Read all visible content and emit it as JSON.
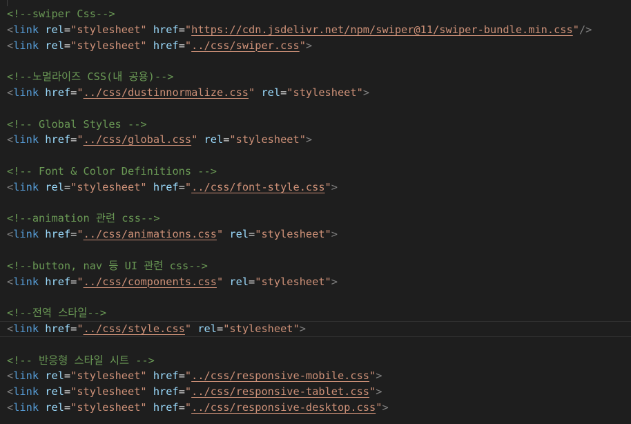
{
  "theme": {
    "background": "#1e1e1e",
    "line_highlight_border": "#303030",
    "indent_guide": "#404040",
    "tokens": {
      "p": "#808080",
      "t": "#569cd6",
      "a": "#9cdcfe",
      "e": "#d4d4d4",
      "s": "#ce9178",
      "u": "#ce9178",
      "c": "#6a9955"
    }
  },
  "editor": {
    "lines": [
      {
        "tokens": [
          {
            "c": "<!--swiper Css-->"
          }
        ]
      },
      {
        "tokens": [
          {
            "p": "<"
          },
          {
            "t": "link"
          },
          {
            "a": " rel"
          },
          {
            "e": "="
          },
          {
            "s": "\"stylesheet\""
          },
          {
            "a": " href"
          },
          {
            "e": "="
          },
          {
            "s": "\""
          },
          {
            "u": "https://cdn.jsdelivr.net/npm/swiper@11/swiper-bundle.min.css"
          },
          {
            "s": "\""
          },
          {
            "p": "/>"
          }
        ]
      },
      {
        "tokens": [
          {
            "p": "<"
          },
          {
            "t": "link"
          },
          {
            "a": " rel"
          },
          {
            "e": "="
          },
          {
            "s": "\"stylesheet\""
          },
          {
            "a": " href"
          },
          {
            "e": "="
          },
          {
            "s": "\""
          },
          {
            "u": "../css/swiper.css"
          },
          {
            "s": "\""
          },
          {
            "p": ">"
          }
        ]
      },
      {
        "tokens": []
      },
      {
        "tokens": [
          {
            "c": "<!--노멀라이즈 CSS(내 공용)-->"
          }
        ]
      },
      {
        "tokens": [
          {
            "p": "<"
          },
          {
            "t": "link"
          },
          {
            "a": " href"
          },
          {
            "e": "="
          },
          {
            "s": "\""
          },
          {
            "u": "../css/dustinnormalize.css"
          },
          {
            "s": "\""
          },
          {
            "a": " rel"
          },
          {
            "e": "="
          },
          {
            "s": "\"stylesheet\""
          },
          {
            "p": ">"
          }
        ]
      },
      {
        "tokens": []
      },
      {
        "tokens": [
          {
            "c": "<!-- Global Styles -->"
          }
        ]
      },
      {
        "tokens": [
          {
            "p": "<"
          },
          {
            "t": "link"
          },
          {
            "a": " href"
          },
          {
            "e": "="
          },
          {
            "s": "\""
          },
          {
            "u": "../css/global.css"
          },
          {
            "s": "\""
          },
          {
            "a": " rel"
          },
          {
            "e": "="
          },
          {
            "s": "\"stylesheet\""
          },
          {
            "p": ">"
          }
        ]
      },
      {
        "tokens": []
      },
      {
        "tokens": [
          {
            "c": "<!-- Font & Color Definitions -->"
          }
        ]
      },
      {
        "tokens": [
          {
            "p": "<"
          },
          {
            "t": "link"
          },
          {
            "a": " rel"
          },
          {
            "e": "="
          },
          {
            "s": "\"stylesheet\""
          },
          {
            "a": " href"
          },
          {
            "e": "="
          },
          {
            "s": "\""
          },
          {
            "u": "../css/font-style.css"
          },
          {
            "s": "\""
          },
          {
            "p": ">"
          }
        ]
      },
      {
        "tokens": []
      },
      {
        "tokens": [
          {
            "c": "<!--animation 관련 css-->"
          }
        ]
      },
      {
        "tokens": [
          {
            "p": "<"
          },
          {
            "t": "link"
          },
          {
            "a": " href"
          },
          {
            "e": "="
          },
          {
            "s": "\""
          },
          {
            "u": "../css/animations.css"
          },
          {
            "s": "\""
          },
          {
            "a": " rel"
          },
          {
            "e": "="
          },
          {
            "s": "\"stylesheet\""
          },
          {
            "p": ">"
          }
        ]
      },
      {
        "tokens": []
      },
      {
        "tokens": [
          {
            "c": "<!--button, nav 등 UI 관련 css-->"
          }
        ]
      },
      {
        "tokens": [
          {
            "p": "<"
          },
          {
            "t": "link"
          },
          {
            "a": " href"
          },
          {
            "e": "="
          },
          {
            "s": "\""
          },
          {
            "u": "../css/components.css"
          },
          {
            "s": "\""
          },
          {
            "a": " rel"
          },
          {
            "e": "="
          },
          {
            "s": "\"stylesheet\""
          },
          {
            "p": ">"
          }
        ]
      },
      {
        "tokens": []
      },
      {
        "tokens": [
          {
            "c": "<!--전역 스타일-->"
          }
        ]
      },
      {
        "active": true,
        "tokens": [
          {
            "p": "<"
          },
          {
            "t": "link"
          },
          {
            "a": " href"
          },
          {
            "e": "="
          },
          {
            "s": "\""
          },
          {
            "u": "../css/style.css"
          },
          {
            "s": "\""
          },
          {
            "a": " rel"
          },
          {
            "e": "="
          },
          {
            "s": "\"stylesheet\""
          },
          {
            "p": ">"
          }
        ]
      },
      {
        "tokens": []
      },
      {
        "tokens": [
          {
            "c": "<!-- 반응형 스타일 시트 -->"
          }
        ]
      },
      {
        "tokens": [
          {
            "p": "<"
          },
          {
            "t": "link"
          },
          {
            "a": " rel"
          },
          {
            "e": "="
          },
          {
            "s": "\"stylesheet\""
          },
          {
            "a": " href"
          },
          {
            "e": "="
          },
          {
            "s": "\""
          },
          {
            "u": "../css/responsive-mobile.css"
          },
          {
            "s": "\""
          },
          {
            "p": ">"
          }
        ]
      },
      {
        "tokens": [
          {
            "p": "<"
          },
          {
            "t": "link"
          },
          {
            "a": " rel"
          },
          {
            "e": "="
          },
          {
            "s": "\"stylesheet\""
          },
          {
            "a": " href"
          },
          {
            "e": "="
          },
          {
            "s": "\""
          },
          {
            "u": "../css/responsive-tablet.css"
          },
          {
            "s": "\""
          },
          {
            "p": ">"
          }
        ]
      },
      {
        "tokens": [
          {
            "p": "<"
          },
          {
            "t": "link"
          },
          {
            "a": " rel"
          },
          {
            "e": "="
          },
          {
            "s": "\"stylesheet\""
          },
          {
            "a": " href"
          },
          {
            "e": "="
          },
          {
            "s": "\""
          },
          {
            "u": "../css/responsive-desktop.css"
          },
          {
            "s": "\""
          },
          {
            "p": ">"
          }
        ]
      }
    ]
  }
}
